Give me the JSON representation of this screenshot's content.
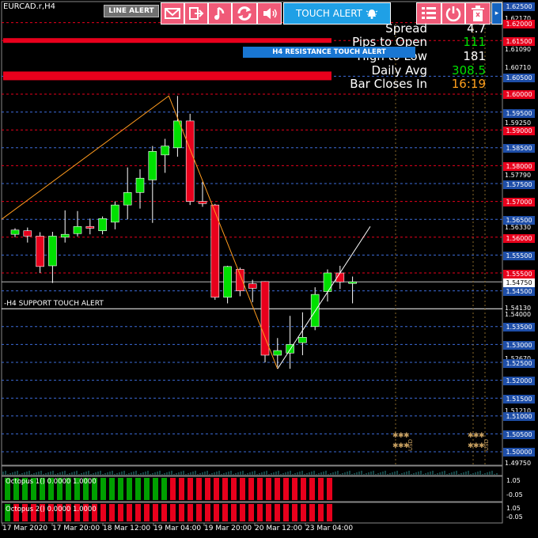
{
  "symbol": "EURCAD.r,H4",
  "toolbar": {
    "line_alert": "LINE ALERT",
    "touch_alert": "TOUCH ALERT",
    "scroll_label": "1.62500"
  },
  "info_panel": {
    "rows": [
      {
        "label": "Spread",
        "value": "4.7",
        "color": "#ffffff"
      },
      {
        "label": "Pips to Open",
        "value": "111",
        "color": "#00e000"
      },
      {
        "label": "High to Low",
        "value": "181",
        "color": "#ffffff"
      },
      {
        "label": "Daily Avg",
        "value": "308.5",
        "color": "#00e000"
      },
      {
        "label": "Bar Closes In",
        "value": "16:19",
        "color": "#ff9f1c"
      }
    ]
  },
  "resistance_banner": "H4 RESISTANCE TOUCH ALERT",
  "support_label": "-H4 SUPPORT TOUCH ALERT",
  "price_axis": [
    {
      "text": "1.62500",
      "style": "blue"
    },
    {
      "text": "1.62170",
      "style": "plain"
    },
    {
      "text": "1.62000",
      "style": "red"
    },
    {
      "text": "1.61500",
      "style": "red"
    },
    {
      "text": "1.61090",
      "style": "plain"
    },
    {
      "text": "1.60710",
      "style": "plain"
    },
    {
      "text": "1.60500",
      "style": "blue"
    },
    {
      "text": "1.60000",
      "style": "red"
    },
    {
      "text": "1.59500",
      "style": "blue"
    },
    {
      "text": "1.59250",
      "style": "plain"
    },
    {
      "text": "1.59000",
      "style": "red"
    },
    {
      "text": "1.58500",
      "style": "blue"
    },
    {
      "text": "1.58000",
      "style": "red"
    },
    {
      "text": "1.57790",
      "style": "plain"
    },
    {
      "text": "1.57500",
      "style": "blue"
    },
    {
      "text": "1.57000",
      "style": "red"
    },
    {
      "text": "1.56500",
      "style": "blue"
    },
    {
      "text": "1.56330",
      "style": "plain"
    },
    {
      "text": "1.56000",
      "style": "red"
    },
    {
      "text": "1.55500",
      "style": "blue"
    },
    {
      "text": "1.55500",
      "style": "red"
    },
    {
      "text": "1.54750",
      "style": "cur"
    },
    {
      "text": "1.54500",
      "style": "blue"
    },
    {
      "text": "1.54130",
      "style": "plain"
    },
    {
      "text": "1.54000",
      "style": "plain"
    },
    {
      "text": "1.53500",
      "style": "blue"
    },
    {
      "text": "1.53000",
      "style": "blue"
    },
    {
      "text": "1.52670",
      "style": "plain"
    },
    {
      "text": "1.52500",
      "style": "blue"
    },
    {
      "text": "1.52000",
      "style": "blue"
    },
    {
      "text": "1.51500",
      "style": "blue"
    },
    {
      "text": "1.51210",
      "style": "plain"
    },
    {
      "text": "1.51000",
      "style": "blue"
    },
    {
      "text": "1.50500",
      "style": "blue"
    },
    {
      "text": "1.50000",
      "style": "blue"
    },
    {
      "text": "1.49750",
      "style": "plain"
    }
  ],
  "candles": [
    {
      "o": 1.5608,
      "h": 1.5625,
      "l": 1.56,
      "c": 1.562
    },
    {
      "o": 1.5618,
      "h": 1.5627,
      "l": 1.5585,
      "c": 1.5603
    },
    {
      "o": 1.5603,
      "h": 1.5614,
      "l": 1.55,
      "c": 1.5518
    },
    {
      "o": 1.552,
      "h": 1.5615,
      "l": 1.5472,
      "c": 1.5603
    },
    {
      "o": 1.56,
      "h": 1.5675,
      "l": 1.5585,
      "c": 1.5608
    },
    {
      "o": 1.561,
      "h": 1.5673,
      "l": 1.5602,
      "c": 1.563
    },
    {
      "o": 1.563,
      "h": 1.5652,
      "l": 1.5608,
      "c": 1.5625
    },
    {
      "o": 1.5618,
      "h": 1.5658,
      "l": 1.5608,
      "c": 1.5652
    },
    {
      "o": 1.5642,
      "h": 1.57,
      "l": 1.5622,
      "c": 1.569
    },
    {
      "o": 1.569,
      "h": 1.5795,
      "l": 1.565,
      "c": 1.5725
    },
    {
      "o": 1.5725,
      "h": 1.579,
      "l": 1.568,
      "c": 1.5765
    },
    {
      "o": 1.576,
      "h": 1.5855,
      "l": 1.564,
      "c": 1.584
    },
    {
      "o": 1.583,
      "h": 1.5875,
      "l": 1.578,
      "c": 1.5855
    },
    {
      "o": 1.585,
      "h": 1.5995,
      "l": 1.5825,
      "c": 1.5925
    },
    {
      "o": 1.5925,
      "h": 1.5945,
      "l": 1.569,
      "c": 1.57
    },
    {
      "o": 1.57,
      "h": 1.5755,
      "l": 1.5685,
      "c": 1.5694
    },
    {
      "o": 1.569,
      "h": 1.5693,
      "l": 1.5425,
      "c": 1.5432
    },
    {
      "o": 1.5432,
      "h": 1.552,
      "l": 1.5415,
      "c": 1.5518
    },
    {
      "o": 1.551,
      "h": 1.5515,
      "l": 1.5435,
      "c": 1.545
    },
    {
      "o": 1.547,
      "h": 1.5481,
      "l": 1.5418,
      "c": 1.5457
    },
    {
      "o": 1.5476,
      "h": 1.5477,
      "l": 1.525,
      "c": 1.527
    },
    {
      "o": 1.527,
      "h": 1.5318,
      "l": 1.5237,
      "c": 1.5283
    },
    {
      "o": 1.5276,
      "h": 1.538,
      "l": 1.5232,
      "c": 1.53
    },
    {
      "o": 1.5305,
      "h": 1.539,
      "l": 1.527,
      "c": 1.532
    },
    {
      "o": 1.535,
      "h": 1.546,
      "l": 1.534,
      "c": 1.544
    },
    {
      "o": 1.5448,
      "h": 1.551,
      "l": 1.542,
      "c": 1.55
    },
    {
      "o": 1.55,
      "h": 1.552,
      "l": 1.5455,
      "c": 1.5475
    },
    {
      "o": 1.5475,
      "h": 1.549,
      "l": 1.5415,
      "c": 1.5475
    }
  ],
  "date_labels": [
    "17 Mar 2020",
    "17 Mar 20:00",
    "18 Mar 12:00",
    "19 Mar 04:00",
    "19 Mar 20:00",
    "20 Mar 12:00",
    "23 Mar 04:00"
  ],
  "indicators": [
    {
      "label": "Octopus 1() 0.0000 1.0000",
      "scale_top": "1.05",
      "scale_bottom": "-0.05",
      "bars": [
        "g",
        "g",
        "g",
        "g",
        "g",
        "g",
        "g",
        "g",
        "g",
        "g",
        "g",
        "g",
        "g",
        "g",
        "g",
        "g",
        "g",
        "g",
        "g",
        "r",
        "r",
        "r",
        "r",
        "r",
        "r",
        "r",
        "r",
        "r",
        "r",
        "r",
        "r",
        "r",
        "r",
        "r",
        "r",
        "r",
        "r",
        "r"
      ]
    },
    {
      "label": "Octopus 2() 0.0000 1.0000",
      "scale_top": "1.05",
      "scale_bottom": "-0.05",
      "bars": [
        "g",
        "r",
        "r",
        "r",
        "r",
        "r",
        "r",
        "r",
        "r",
        "r",
        "r",
        "r",
        "r",
        "r",
        "r",
        "r",
        "r",
        "r",
        "r",
        "r",
        "r",
        "r",
        "r",
        "r",
        "r",
        "r",
        "r",
        "r",
        "r",
        "r",
        "r",
        "r",
        "r",
        "r",
        "r",
        "r",
        "r",
        "r"
      ]
    }
  ],
  "news_tags": [
    "USD",
    "USD"
  ],
  "colors": {
    "bull": "#00e000",
    "bear": "#e8001c",
    "resistance": "#e8001c",
    "support_grid": "#3d6cd9",
    "trend": "#ff9b1e",
    "uptrend": "#ffffff"
  }
}
